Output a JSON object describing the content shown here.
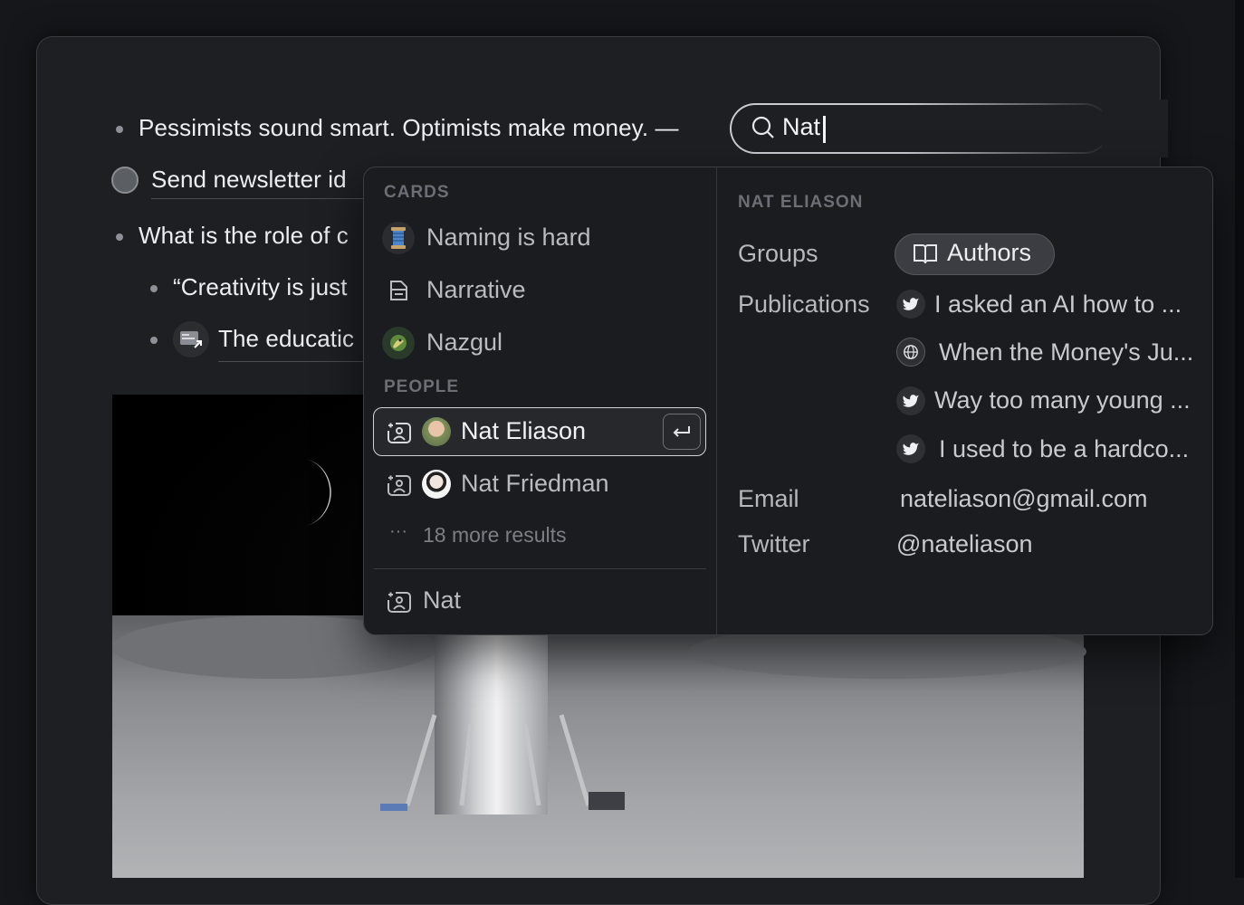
{
  "document": {
    "line1": "Pessimists sound smart. Optimists make money. —",
    "line2": "Send newsletter id",
    "line3": "What is the role of c",
    "line4": "“Creativity is just",
    "line5": "The educatic"
  },
  "search": {
    "query": "Nat",
    "icon": "search-icon"
  },
  "dropdown": {
    "cards_label": "CARDS",
    "cards": [
      {
        "label": "Naming is hard",
        "icon": "spool-icon"
      },
      {
        "label": "Narrative",
        "icon": "document-icon"
      },
      {
        "label": "Nazgul",
        "icon": "nazgul-icon"
      }
    ],
    "people_label": "PEOPLE",
    "people": [
      {
        "label": "Nat Eliason",
        "icon": "person-card-icon"
      },
      {
        "label": "Nat Friedman",
        "icon": "person-card-icon"
      }
    ],
    "more_results": "18 more results",
    "create_label": "Nat"
  },
  "detail": {
    "heading": "NAT ELIASON",
    "groups_label": "Groups",
    "group_chip": "Authors",
    "publications_label": "Publications",
    "publications": [
      {
        "title": "I asked an AI how to ...",
        "icon": "twitter-icon"
      },
      {
        "title": "When the Money's Ju...",
        "icon": "globe-icon"
      },
      {
        "title": "Way too many young ...",
        "icon": "twitter-icon"
      },
      {
        "title": "I used to be a hardco...",
        "icon": "twitter-icon"
      }
    ],
    "email_label": "Email",
    "email_value": "nateliason@gmail.com",
    "twitter_label": "Twitter",
    "twitter_value": "@nateliason"
  },
  "colors": {
    "background": "#16171a",
    "panel": "#1b1c1f",
    "text": "#e9eaec",
    "muted": "#6b6e75"
  }
}
